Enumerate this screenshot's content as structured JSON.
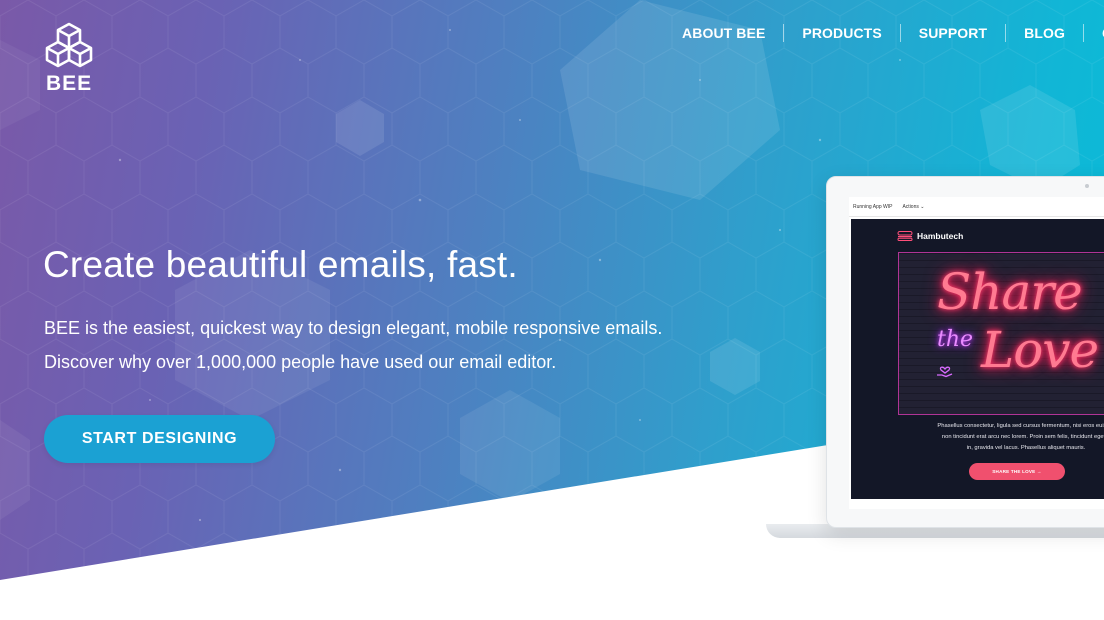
{
  "brand": {
    "logo_text": "BEE"
  },
  "nav": {
    "items": [
      {
        "label": "ABOUT BEE"
      },
      {
        "label": "PRODUCTS"
      },
      {
        "label": "SUPPORT"
      },
      {
        "label": "BLOG"
      },
      {
        "label": "C"
      }
    ]
  },
  "hero": {
    "headline": "Create beautiful emails, fast.",
    "subline_1": "BEE is the easiest, quickest way to design elegant, mobile responsive emails.",
    "subline_2": "Discover why over 1,000,000 people have used our email editor.",
    "cta_label": "START DESIGNING"
  },
  "mockup": {
    "app_name": "Running App WIP",
    "actions_label": "Actions ⌄",
    "email_brand": "Hambutech",
    "neon_share": "Share",
    "neon_the": "the",
    "neon_love": "Love",
    "body_lines": [
      "Phasellus consectetur, ligula sed cursus fermentum, nisi eros euismo",
      "non tincidunt erat arcu nec lorem. Proin sem felis, tincidunt eget n",
      "in, gravida vel lacus. Phasellus aliquet mauris."
    ],
    "email_button": "SHARE THE LOVE →"
  },
  "colors": {
    "gradient_start": "#7a59a8",
    "gradient_end": "#08bcd8",
    "cta_bg": "#1ba1d3",
    "email_bg": "#131727",
    "email_button": "#f0506e"
  }
}
